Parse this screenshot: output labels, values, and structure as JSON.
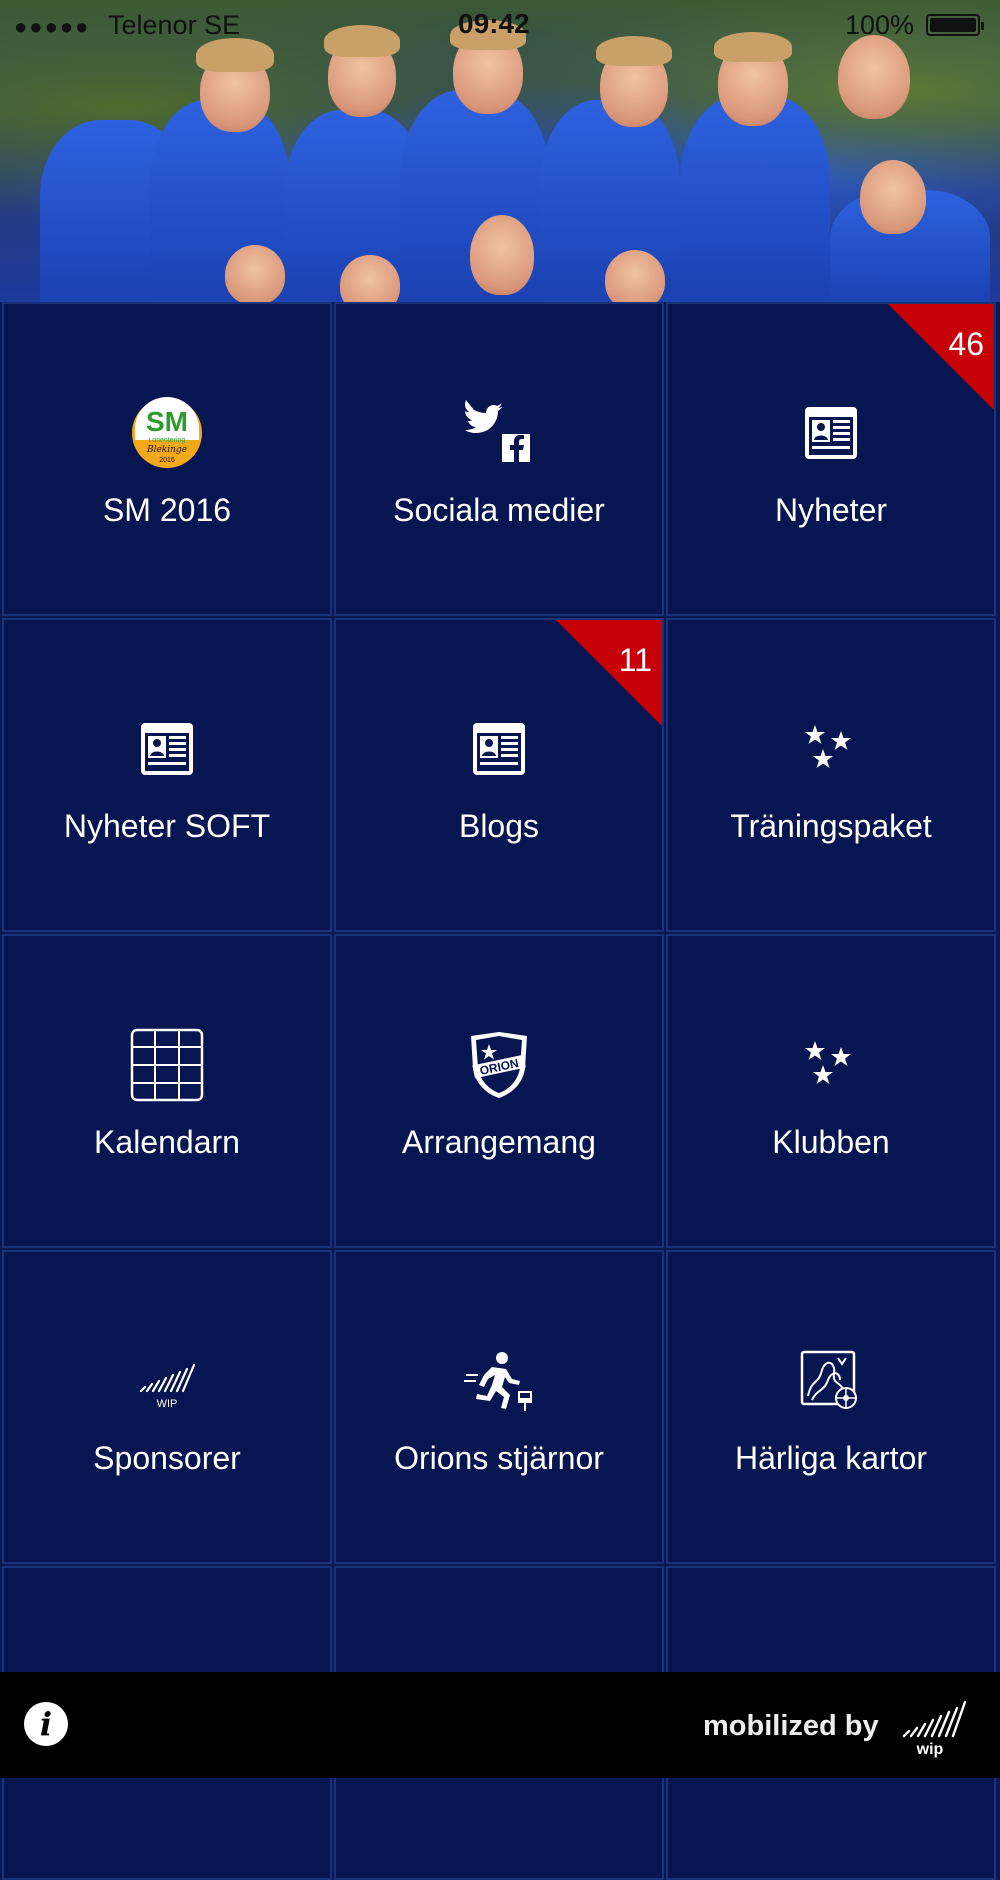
{
  "status_bar": {
    "signal": "●●●●●",
    "carrier": "Telenor SE",
    "time": "09:42",
    "battery": "100%"
  },
  "tiles": [
    {
      "label": "SM 2016",
      "icon": "sm-2016-logo-icon"
    },
    {
      "label": "Sociala medier",
      "icon": "twitter-facebook-icon"
    },
    {
      "label": "Nyheter",
      "icon": "newspaper-icon",
      "badge": "46"
    },
    {
      "label": "Nyheter SOFT",
      "icon": "newspaper-icon"
    },
    {
      "label": "Blogs",
      "icon": "newspaper-icon",
      "badge": "11"
    },
    {
      "label": "Träningspaket",
      "icon": "stars-icon"
    },
    {
      "label": "Kalendarn",
      "icon": "calendar-grid-icon"
    },
    {
      "label": "Arrangemang",
      "icon": "orion-shield-icon"
    },
    {
      "label": "Klubben",
      "icon": "stars-icon"
    },
    {
      "label": "Sponsorer",
      "icon": "wip-logo-icon"
    },
    {
      "label": "Orions stjärnor",
      "icon": "runner-icon"
    },
    {
      "label": "Härliga kartor",
      "icon": "orienteering-map-icon"
    }
  ],
  "sm_logo": {
    "top": "SM",
    "line1": "i orientering",
    "line2": "Blekinge",
    "year": "2016"
  },
  "sponsor_logo_text": "WIP",
  "orion_shield_text": "ORION",
  "footer": {
    "info": "i",
    "mobilized": "mobilized by",
    "wip": "wip"
  },
  "colors": {
    "tile_bg": "#071650",
    "grid_line": "#1a3278",
    "badge": "#c8000a",
    "footer": "#000000"
  }
}
